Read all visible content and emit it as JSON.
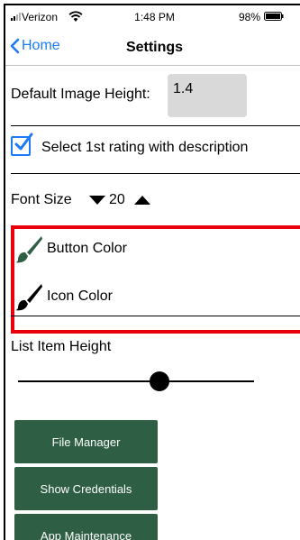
{
  "status_bar": {
    "carrier": "Verizon",
    "time": "1:48 PM",
    "battery": "98%"
  },
  "nav": {
    "back_label": "Home",
    "title": "Settings"
  },
  "settings": {
    "image_height_label": "Default Image Height:",
    "image_height_value": "1.4",
    "rating_label": "Select 1st rating with description",
    "rating_checked": true,
    "font_size_label": "Font Size",
    "font_size_value": "20",
    "button_color_label": "Button Color",
    "icon_color_label": "Icon Color",
    "list_item_height_label": "List Item Height",
    "list_item_height_level": 0.6
  },
  "buttons": {
    "file_manager": "File Manager",
    "show_credentials": "Show Credentials",
    "app_maintenance": "App Maintenance"
  },
  "colors": {
    "accent": "#1c7cf5",
    "button_green": "#2e5f44",
    "button_brush": "#2e5f44",
    "icon_brush": "#000000",
    "highlight": "#e8000b"
  },
  "icons": {
    "back": "chevron-left-icon",
    "checkbox": "checkmark-icon",
    "font_down": "triangle-down-icon",
    "font_up": "triangle-up-icon",
    "button_color": "paintbrush-icon",
    "icon_color": "paintbrush-icon"
  }
}
